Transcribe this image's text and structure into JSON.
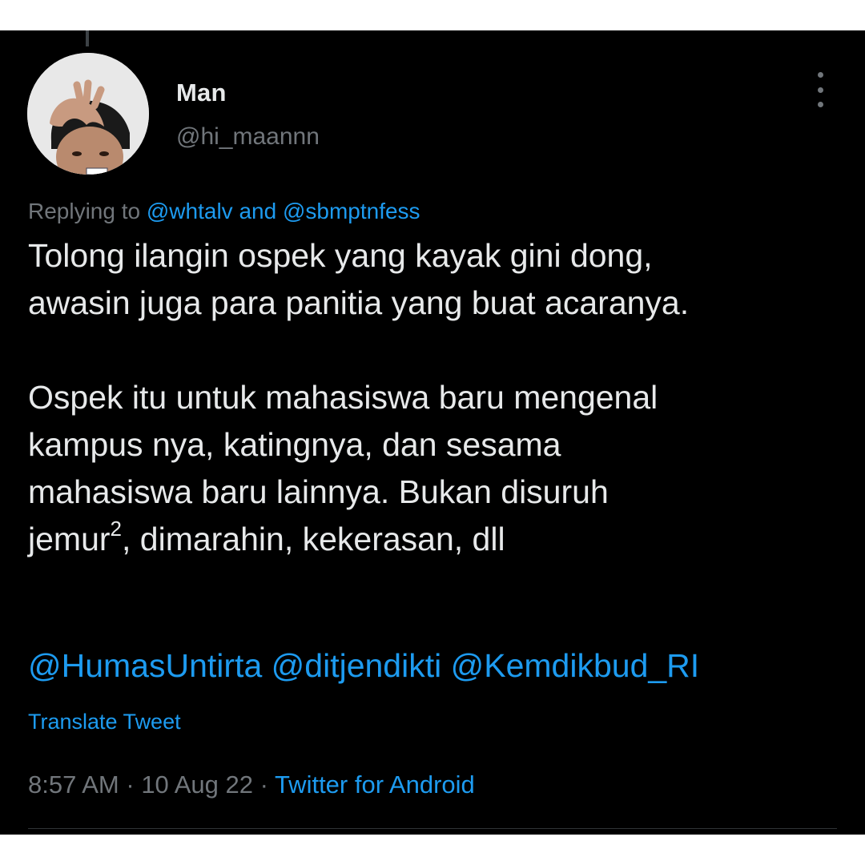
{
  "tweet": {
    "author": {
      "display_name": "Man",
      "handle": "@hi_maannn",
      "avatar_icon": "profile-photo"
    },
    "more_icon": "more-vertical-icon",
    "reply": {
      "prefix": "Replying to ",
      "mention_1": "@whtalv",
      "joiner": " and ",
      "mention_2": "@sbmptnfess"
    },
    "text": {
      "para1_line1": "Tolong ilangin ospek yang kayak gini dong,",
      "para1_line2": "awasin juga para panitia yang buat acaranya.",
      "para2_line1": "Ospek itu untuk mahasiswa baru mengenal",
      "para2_line2": "kampus nya, katingnya, dan sesama",
      "para2_line3": "mahasiswa baru lainnya. Bukan disuruh",
      "para2_line4_pre": "jemur",
      "para2_line4_sup": "2",
      "para2_line4_post": ", dimarahin, kekerasan, dll"
    },
    "mentions": [
      "@HumasUntirta",
      "@ditjendikti",
      "@Kemdikbud_RI"
    ],
    "translate_label": "Translate Tweet",
    "meta": {
      "time": "8:57 AM",
      "separator": " · ",
      "date": "10 Aug 22",
      "source": "Twitter for Android"
    }
  },
  "colors": {
    "background": "#000000",
    "text_primary": "#e7e9ea",
    "text_secondary": "#71767b",
    "accent": "#1d9bf0"
  }
}
